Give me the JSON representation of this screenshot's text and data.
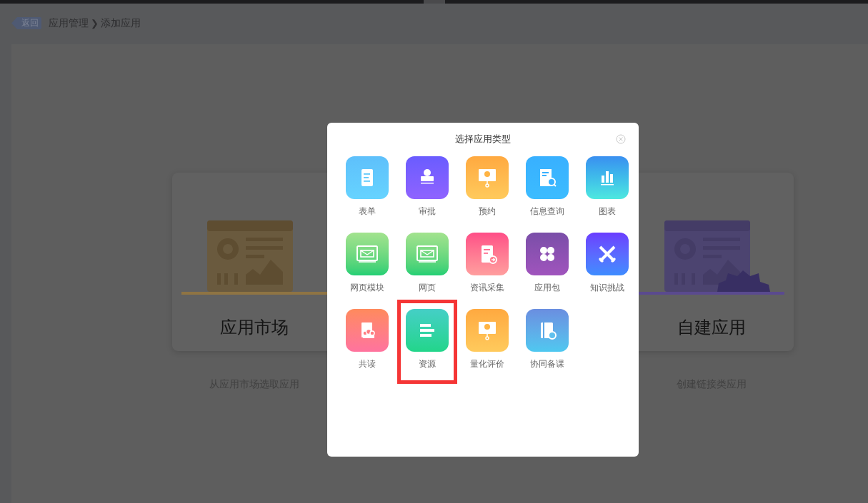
{
  "breadcrumb": {
    "back": "返回",
    "path": "应用管理",
    "separator": "❯",
    "current": "添加应用"
  },
  "cards": [
    {
      "title": "应用市场",
      "description": "从应用市场选取应用"
    },
    {
      "title": "自建应用",
      "description": "创建链接类应用"
    }
  ],
  "dialog": {
    "title": "选择应用类型",
    "items": [
      {
        "label": "表单",
        "highlighted": false
      },
      {
        "label": "审批",
        "highlighted": false
      },
      {
        "label": "预约",
        "highlighted": false
      },
      {
        "label": "信息查询",
        "highlighted": false
      },
      {
        "label": "图表",
        "highlighted": false
      },
      {
        "label": "网页模块",
        "highlighted": false
      },
      {
        "label": "网页",
        "highlighted": false
      },
      {
        "label": "资讯采集",
        "highlighted": false
      },
      {
        "label": "应用包",
        "highlighted": false
      },
      {
        "label": "知识挑战",
        "highlighted": false
      },
      {
        "label": "共读",
        "highlighted": false
      },
      {
        "label": "资源",
        "highlighted": true
      },
      {
        "label": "量化评价",
        "highlighted": false
      },
      {
        "label": "协同备课",
        "highlighted": false
      }
    ]
  }
}
